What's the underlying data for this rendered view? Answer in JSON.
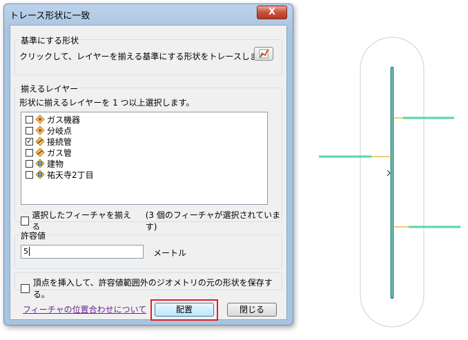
{
  "dialog": {
    "title": "トレース形状に一致",
    "close_symbol": "X",
    "reference": {
      "legend": "基準にする形状",
      "instruction": "クリックして、レイヤーを揃える基準にする形状をトレースします。"
    },
    "layers": {
      "legend": "揃えるレイヤー",
      "instruction": "形状に揃えるレイヤーを 1 つ以上選択します。",
      "items": [
        {
          "label": "ガス機器",
          "checked": false
        },
        {
          "label": "分岐点",
          "checked": false
        },
        {
          "label": "接続管",
          "checked": true
        },
        {
          "label": "ガス管",
          "checked": false
        },
        {
          "label": "建物",
          "checked": false
        },
        {
          "label": "祐天寺2丁目",
          "checked": false
        }
      ],
      "selected_only_label": "選択したフィーチャを揃える",
      "selected_count_text": "(3 個のフィーチャが選択されています)"
    },
    "tolerance": {
      "legend": "許容値",
      "value": "5",
      "unit": "メートル"
    },
    "insert_vertices_label": "頂点を挿入して、許容値範囲外のジオメトリの元の形状を保存する。",
    "help_link": "フィーチャの位置合わせについて",
    "place_button": "配置",
    "close_button": "閉じる"
  },
  "colors": {
    "trace_line": "#3f8f82",
    "connector": "#55d6a8",
    "connector_join": "#e8b84a",
    "highlight": "#e0201c"
  }
}
